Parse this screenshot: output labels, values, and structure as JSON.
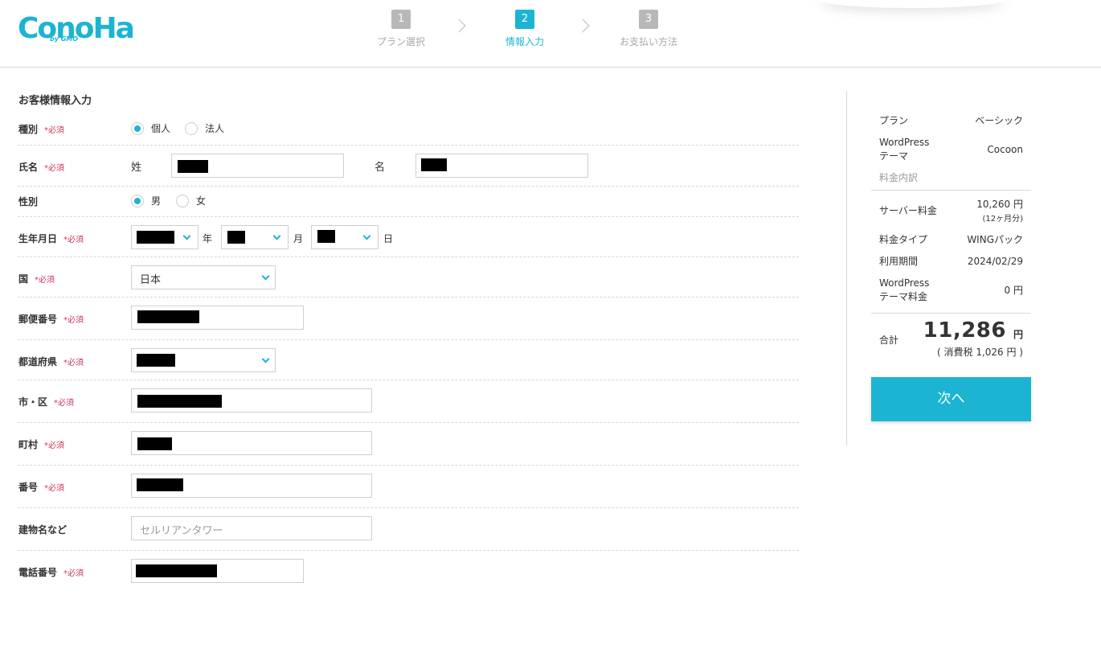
{
  "logo": {
    "main": "ConoHa",
    "sub": "by GMO"
  },
  "steps": [
    {
      "num": "1",
      "label": "プラン選択"
    },
    {
      "num": "2",
      "label": "情報入力"
    },
    {
      "num": "3",
      "label": "お支払い方法"
    }
  ],
  "form": {
    "title": "お客様情報入力",
    "required_mark": "*必須",
    "type": {
      "label": "種別",
      "options": [
        "個人",
        "法人"
      ],
      "selected": "個人"
    },
    "name": {
      "label": "氏名",
      "last_label": "姓",
      "first_label": "名"
    },
    "gender": {
      "label": "性別",
      "options": [
        "男",
        "女"
      ],
      "selected": "男"
    },
    "birthdate": {
      "label": "生年月日",
      "year_unit": "年",
      "month_unit": "月",
      "day_unit": "日"
    },
    "country": {
      "label": "国",
      "value": "日本"
    },
    "postal": {
      "label": "郵便番号"
    },
    "prefecture": {
      "label": "都道府県"
    },
    "city": {
      "label": "市・区"
    },
    "town": {
      "label": "町村"
    },
    "street": {
      "label": "番号"
    },
    "building": {
      "label": "建物名など",
      "placeholder": "セルリアンタワー"
    },
    "phone": {
      "label": "電話番号"
    }
  },
  "summary": {
    "plan_label": "プラン",
    "plan_value": "ベーシック",
    "theme_label": "WordPress\nテーマ",
    "theme_value": "Cocoon",
    "breakdown_label": "料金内訳",
    "server_label": "サーバー料金",
    "server_value": "10,260 円",
    "server_note": "(12ヶ月分)",
    "fee_type_label": "料金タイプ",
    "fee_type_value": "WINGパック",
    "period_label": "利用期間",
    "period_value": "2024/02/29",
    "theme_fee_label": "WordPress\nテーマ料金",
    "theme_fee_value": "0 円",
    "total_label": "合計",
    "total_value": "11,286",
    "total_unit": "円",
    "tax_note": "( 消費税 1,026 円 )",
    "next_button": "次へ"
  },
  "colors": {
    "accent": "#1cb4d3",
    "required": "#c8385b"
  }
}
